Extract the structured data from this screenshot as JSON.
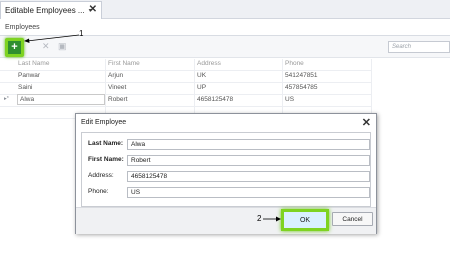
{
  "tab": {
    "title": "Editable Employees ...",
    "pin_glyph": "▾",
    "close_glyph": "✕"
  },
  "subtab": {
    "label": "Employees"
  },
  "toolbar": {
    "add_glyph": "+",
    "delete_glyph": "✕",
    "edit_glyph": "▣",
    "search_placeholder": "Search"
  },
  "grid": {
    "columns": [
      "Last Name",
      "First Name",
      "Address",
      "Phone"
    ],
    "rows": [
      [
        "Panwar",
        "Arjun",
        "UK",
        "541247851"
      ],
      [
        "Saini",
        "Vineet",
        "UP",
        "457854785"
      ],
      [
        "Alwa",
        "Robert",
        "4658125478",
        "US"
      ]
    ],
    "row_marker": "▸*"
  },
  "dialog": {
    "title": "Edit Employee",
    "close_glyph": "✕",
    "fields": [
      {
        "label": "Last Name:",
        "value": "Alwa"
      },
      {
        "label": "First Name:",
        "value": "Robert"
      },
      {
        "label": "Address:",
        "value": "4658125478"
      },
      {
        "label": "Phone:",
        "value": "US"
      }
    ],
    "ok_label": "OK",
    "cancel_label": "Cancel"
  },
  "callouts": {
    "one": "1",
    "two": "2"
  },
  "colors": {
    "highlight_green": "#7ed321",
    "accent_blue": "#d9f0ff"
  }
}
